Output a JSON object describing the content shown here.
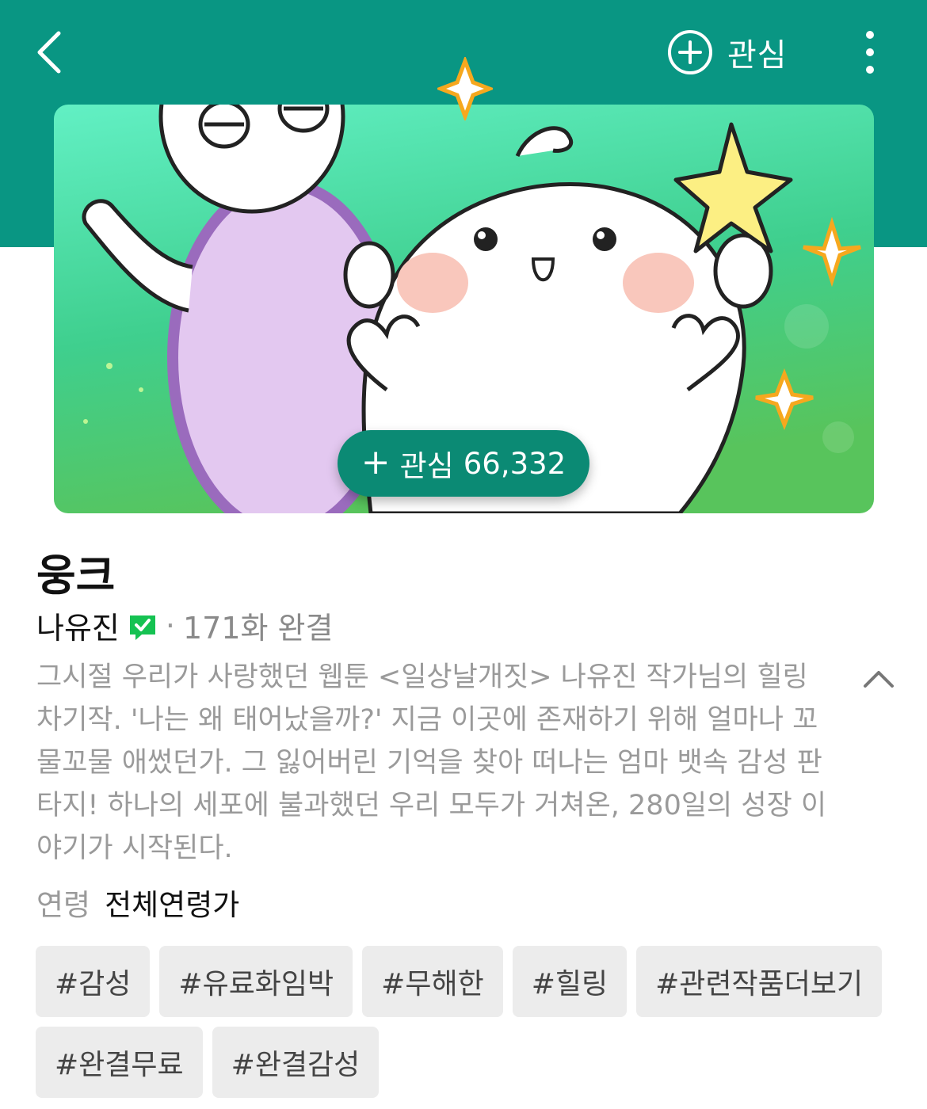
{
  "header": {
    "back_icon": "chevron-left-icon",
    "favorite_label": "관심",
    "favorite_icon": "plus-circle-icon",
    "more_icon": "vertical-dots-icon",
    "bg_color": "#099683"
  },
  "banner": {
    "favorite_count_label": "관심",
    "favorite_count": "66,332"
  },
  "webtoon": {
    "title": "웅크",
    "author": "나유진",
    "verified_icon": "verified-chat-icon",
    "dot": "·",
    "episodes": "171화 완결",
    "description": "그시절 우리가 사랑했던 웹툰 <일상날개짓> 나유진 작가님의 힐링 차기작. '나는 왜 태어났을까?' 지금 이곳에 존재하기 위해 얼마나 꼬물꼬물 애썼던가. 그 잃어버린 기억을 찾아 떠나는 엄마 뱃속 감성 판타지! 하나의 세포에 불과했던 우리 모두가 거쳐온, 280일의 성장 이야기가 시작된다.",
    "collapse_icon": "chevron-up-icon",
    "age_label": "연령",
    "age_value": "전체연령가"
  },
  "tags": [
    "#감성",
    "#유료화임박",
    "#무해한",
    "#힐링",
    "#관련작품더보기",
    "#완결무료",
    "#완결감성"
  ]
}
